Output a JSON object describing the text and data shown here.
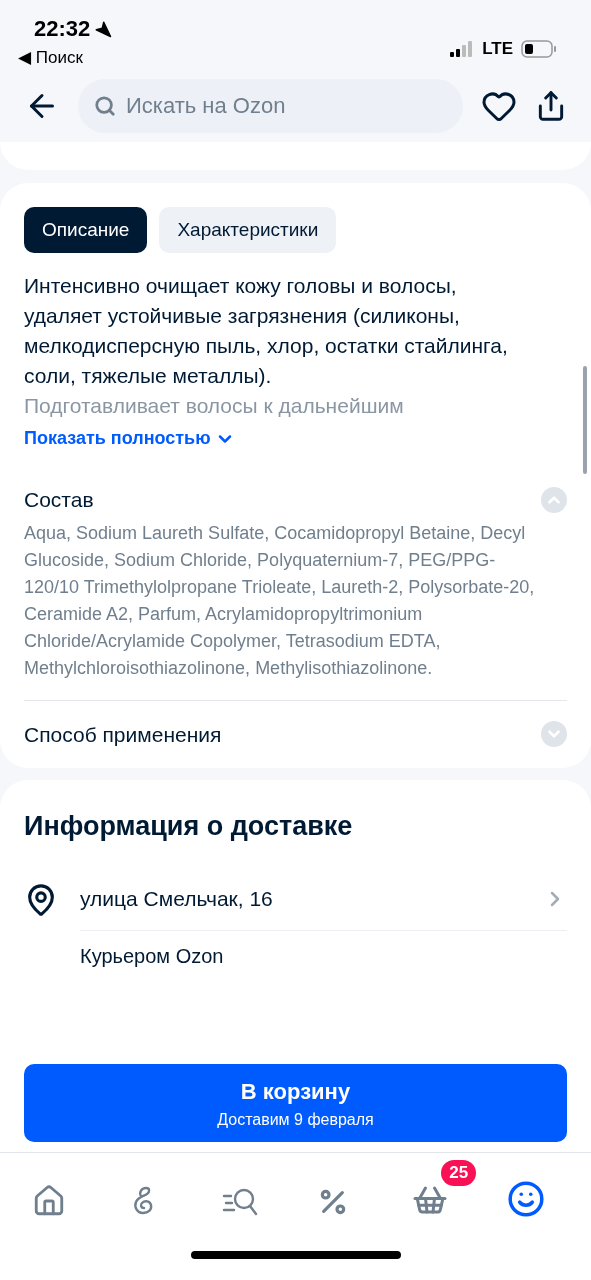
{
  "status_bar": {
    "time": "22:32",
    "back_link": "◀ Поиск",
    "network": "LTE"
  },
  "header": {
    "search": {
      "placeholder": "Искать на Ozon"
    }
  },
  "tabs": [
    {
      "label": "Описание",
      "selected": true
    },
    {
      "label": "Характеристики",
      "selected": false
    }
  ],
  "description": {
    "text": "Интенсивно очищает кожу головы и волосы, удаляет устойчивые загрязнения (силиконы, мелкодисперсную пыль, хлор, остатки стайлинга, соли, тяжелые металлы).",
    "faded_text": "Подготавливает волосы к дальнейшим",
    "show_more": "Показать полностью"
  },
  "sections": [
    {
      "title": "Состав",
      "expanded": true,
      "body": "Aqua, Sodium Laureth Sulfate, Cocamidopropyl Betaine, Decyl Glucoside, Sodium Chloride, Polyquaternium-7, PEG/PPG-120/10 Trimethylolpropane Trioleate, Laureth-2, Polysorbate-20, Ceramide A2, Parfum, Acrylamidopropyltrimonium Chloride/Acrylamide Copolymer, Tetrasodium EDTA, Methylchloroisothiazolinone, Methylisothiazolinone."
    },
    {
      "title": "Способ применения",
      "expanded": false
    }
  ],
  "delivery": {
    "title": "Информация о доставке",
    "address": "улица Смельчак, 16",
    "method": "Курьером Ozon"
  },
  "cart_button": {
    "label": "В корзину",
    "sublabel": "Доставим 9 февраля"
  },
  "nav": [
    {
      "kind": "home",
      "selected": false
    },
    {
      "kind": "fresh",
      "selected": false
    },
    {
      "kind": "catalog",
      "selected": false
    },
    {
      "kind": "sale",
      "selected": false
    },
    {
      "kind": "cart",
      "selected": false,
      "badge": "25"
    },
    {
      "kind": "profile",
      "selected": true
    }
  ]
}
